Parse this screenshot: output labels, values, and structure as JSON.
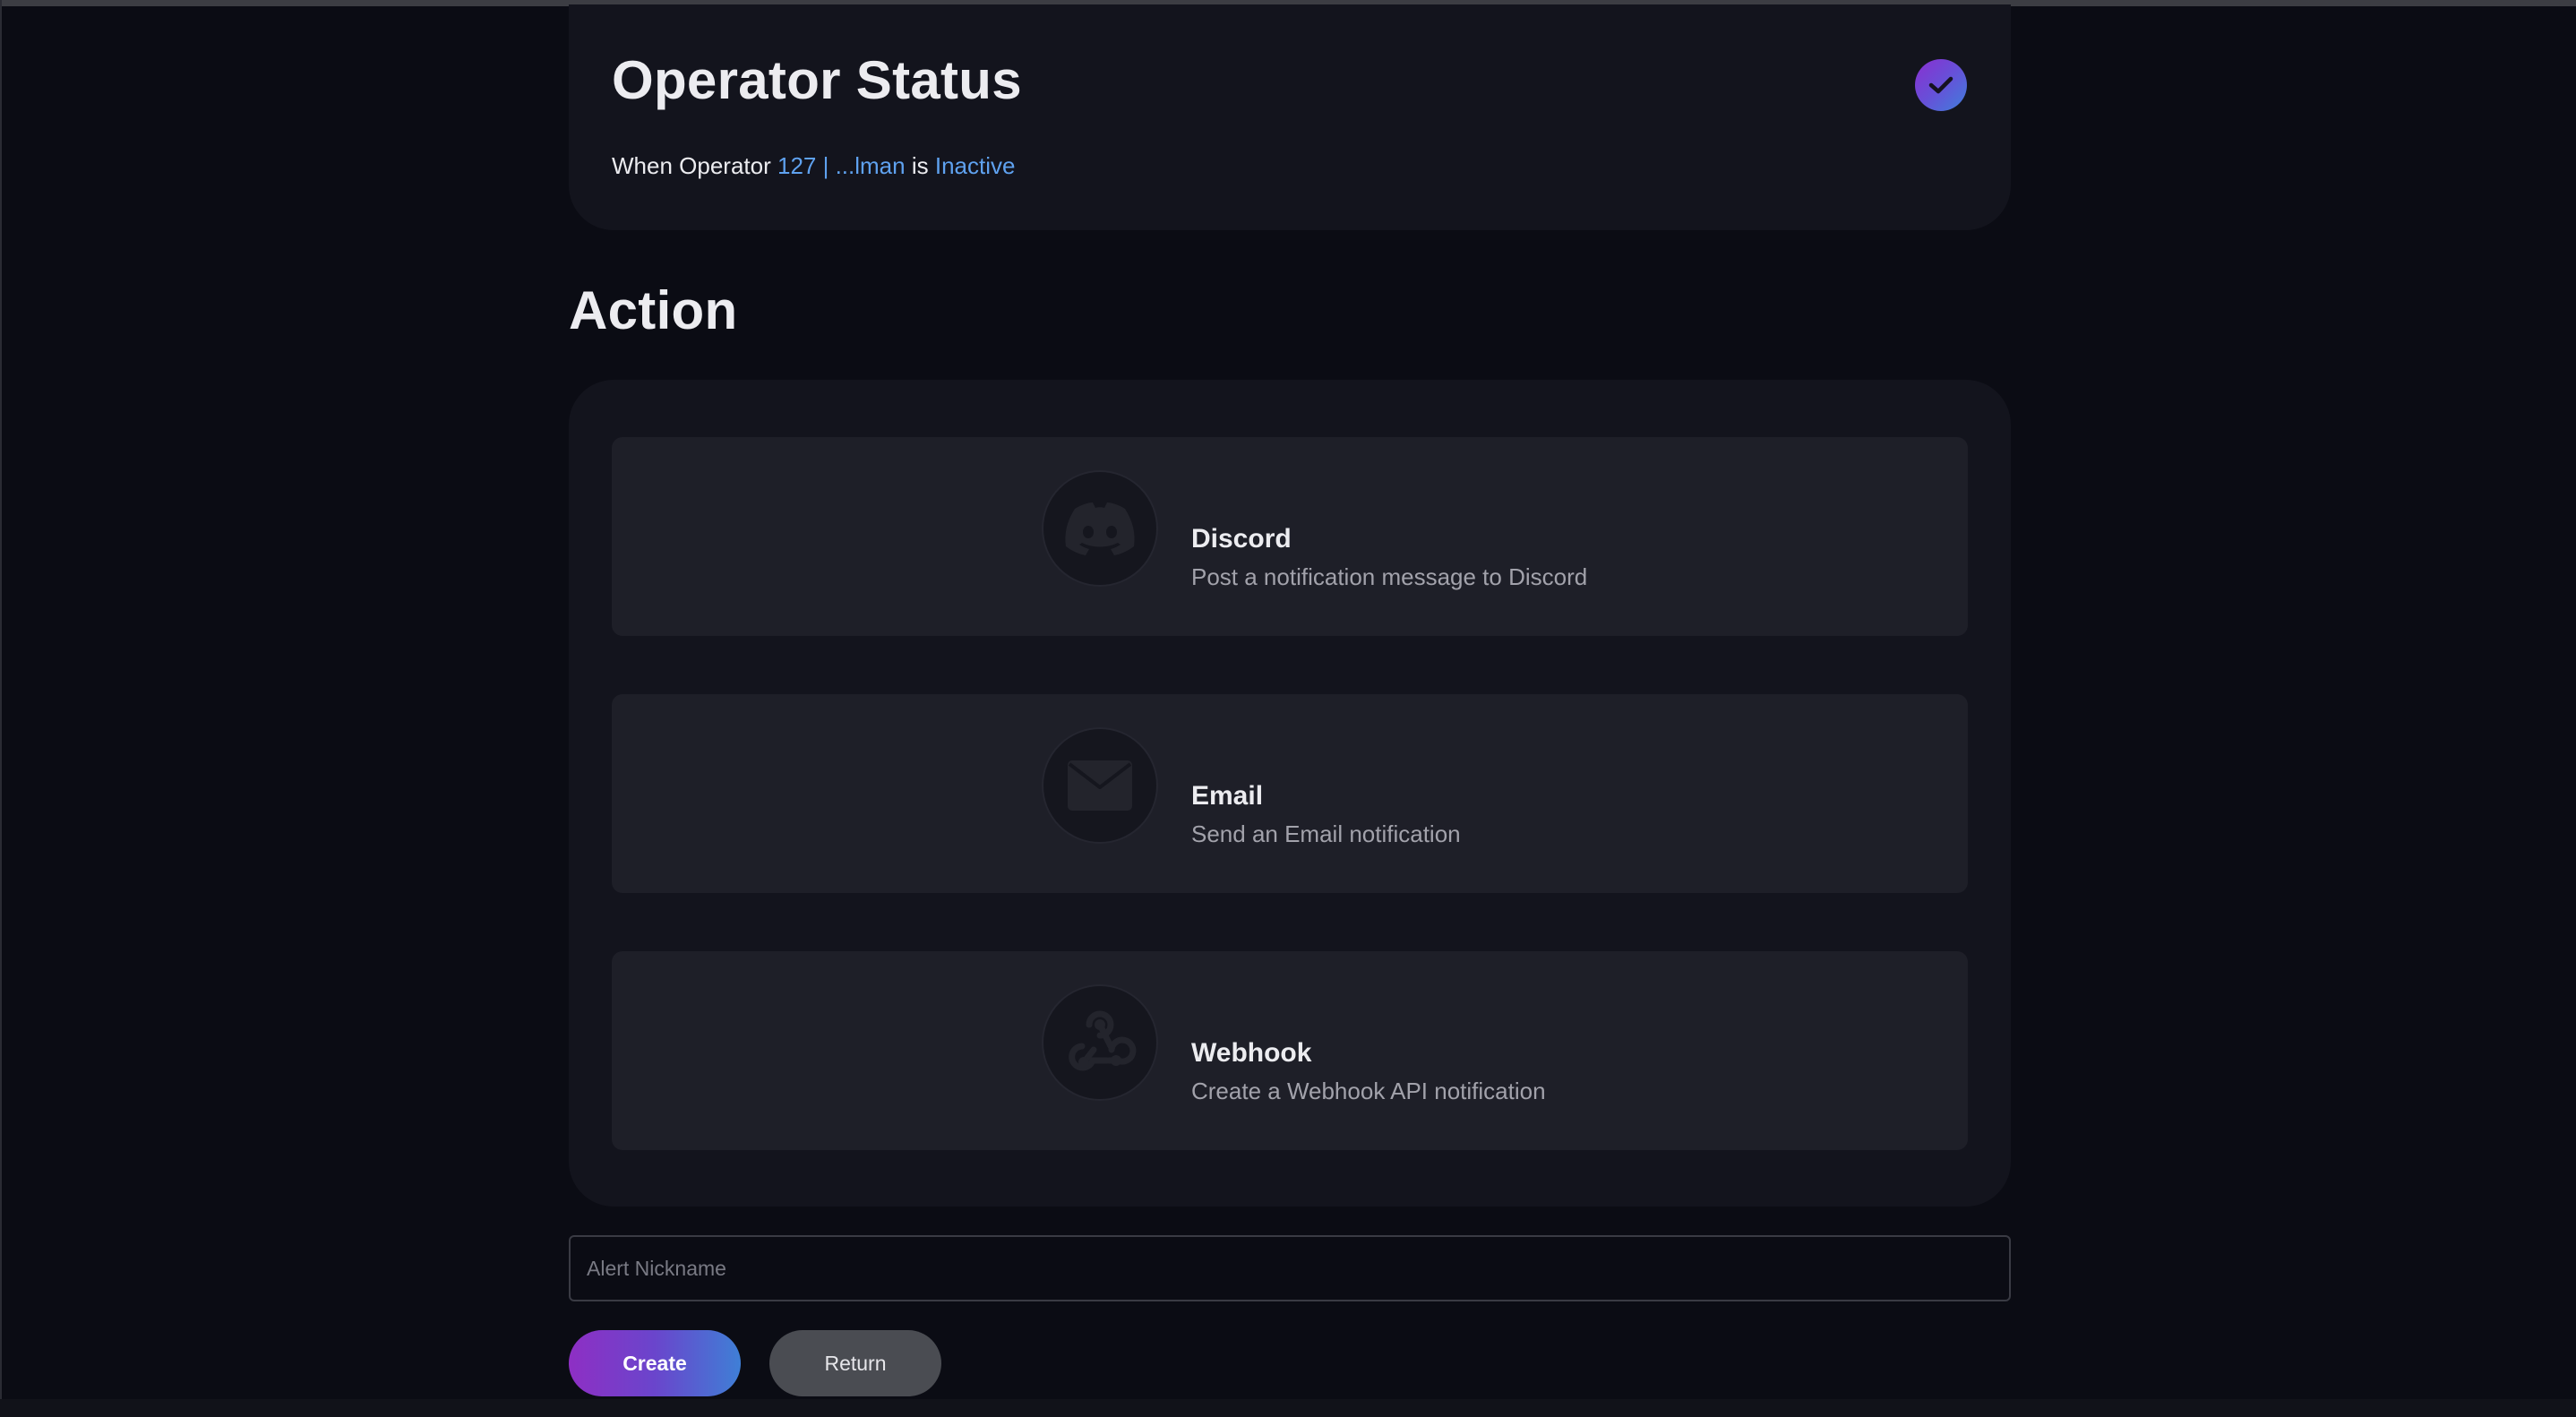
{
  "status_card": {
    "title": "Operator Status",
    "desc_prefix": "When Operator",
    "operator_link": "127 | ...lman",
    "desc_mid": "is",
    "status_link": "Inactive",
    "check_icon": "check-icon"
  },
  "action": {
    "title": "Action",
    "items": [
      {
        "name": "Discord",
        "description": "Post a notification message to Discord",
        "icon": "discord-icon"
      },
      {
        "name": "Email",
        "description": "Send an Email notification",
        "icon": "mail-icon"
      },
      {
        "name": "Webhook",
        "description": "Create a Webhook API notification",
        "icon": "webhook-icon"
      }
    ]
  },
  "nickname": {
    "value": "",
    "placeholder": "Alert Nickname"
  },
  "buttons": {
    "create_label": "Create",
    "return_label": "Return"
  },
  "colors": {
    "background": "#0b0c14",
    "card": "#13141d",
    "item": "#1e1f28",
    "link": "#5fa2f0",
    "accent_gradient_start": "#8e2fc4",
    "accent_gradient_end": "#3f7fd6",
    "return_button": "#4a4c52"
  }
}
